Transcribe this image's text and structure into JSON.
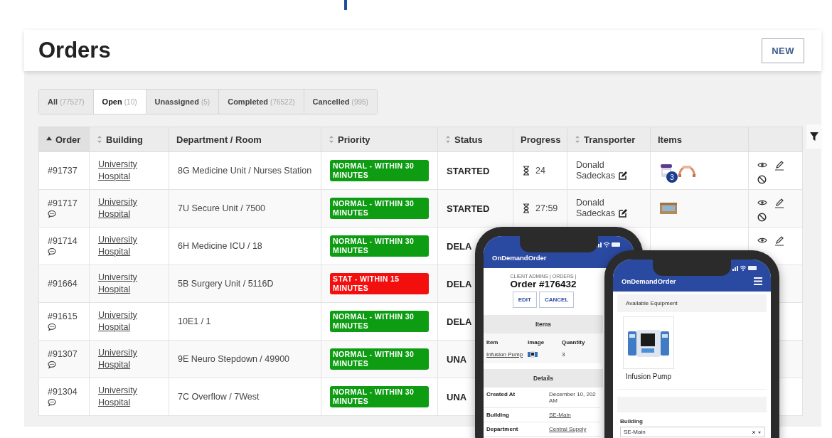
{
  "header": {
    "title": "Orders",
    "new_button": "NEW"
  },
  "tabs": [
    {
      "label": "All",
      "count": "(77527)",
      "selected": false
    },
    {
      "label": "Open",
      "count": "(10)",
      "selected": true
    },
    {
      "label": "Unassigned",
      "count": "(5)",
      "selected": false
    },
    {
      "label": "Completed",
      "count": "(76522)",
      "selected": false
    },
    {
      "label": "Cancelled",
      "count": "(995)",
      "selected": false
    }
  ],
  "table": {
    "columns": [
      {
        "label": "Order",
        "sorted": true
      },
      {
        "label": "Building",
        "sorted": false
      },
      {
        "label": "Department / Room"
      },
      {
        "label": "Priority",
        "sorted": false
      },
      {
        "label": "Status",
        "sorted": false
      },
      {
        "label": "Progress"
      },
      {
        "label": "Transporter",
        "sorted": false
      },
      {
        "label": "Items"
      }
    ],
    "rows": [
      {
        "order": "#91737",
        "comment": false,
        "building": "University Hospital",
        "department": "8G Medicine Unit / Nurses Station",
        "priority": {
          "label": "NORMAL - WITHIN 30 MINUTES",
          "kind": "normal"
        },
        "status": "STARTED",
        "progress": "24",
        "transporter": "Donald Sadeckas",
        "items": [
          {
            "kind": "jar",
            "badge": "3"
          },
          {
            "kind": "strap"
          }
        ],
        "actions": [
          {
            "kind": "view"
          },
          {
            "kind": "edit"
          },
          {
            "kind": "cancel"
          }
        ]
      },
      {
        "order": "#91717",
        "comment": true,
        "building": "University Hospital",
        "department": "7U Secure Unit / 7500",
        "priority": {
          "label": "NORMAL - WITHIN 30 MINUTES",
          "kind": "normal"
        },
        "status": "STARTED",
        "progress": "27:59",
        "transporter": "Donald Sadeckas",
        "items": [
          {
            "kind": "box"
          }
        ],
        "actions": [
          {
            "kind": "view"
          },
          {
            "kind": "edit"
          },
          {
            "kind": "cancel"
          }
        ]
      },
      {
        "order": "#91714",
        "comment": true,
        "building": "University Hospital",
        "department": "6H Medicine ICU / 18",
        "priority": {
          "label": "NORMAL - WITHIN 30 MINUTES",
          "kind": "normal"
        },
        "status": "DELA",
        "actions": [
          {
            "kind": "view"
          },
          {
            "kind": "edit"
          }
        ]
      },
      {
        "order": "#91664",
        "comment": false,
        "building": "University Hospital",
        "department": "5B Surgery Unit / 5116D",
        "priority": {
          "label": "STAT - WITHIN 15 MINUTES",
          "kind": "stat"
        },
        "status": "DELA"
      },
      {
        "order": "#91615",
        "comment": true,
        "building": "University Hospital",
        "department": "10E1 / 1",
        "priority": {
          "label": "NORMAL - WITHIN 30 MINUTES",
          "kind": "normal"
        },
        "status": "DELA"
      },
      {
        "order": "#91307",
        "comment": true,
        "building": "University Hospital",
        "department": "9E Neuro Stepdown / 49900",
        "priority": {
          "label": "NORMAL - WITHIN 30 MINUTES",
          "kind": "normal"
        },
        "status": "UNA"
      },
      {
        "order": "#91304",
        "comment": true,
        "building": "University Hospital",
        "department": "7C Overflow / 7West",
        "priority": {
          "label": "NORMAL - WITHIN 30 MINUTES",
          "kind": "normal"
        },
        "status": "UNA"
      }
    ]
  },
  "phones": [
    {
      "app_title": "OnDemandOrder",
      "breadcrumb": "CLIENT ADMINS | ORDERS |",
      "order_title": "Order #176432",
      "buttons": [
        "EDIT",
        "CANCEL"
      ],
      "items_section": {
        "title": "Items",
        "columns": [
          "Item",
          "Image",
          "Quantity"
        ],
        "rows": [
          {
            "item": "Infusion Pump",
            "quantity": "3"
          }
        ]
      },
      "details_section": {
        "title": "Details",
        "rows": [
          {
            "label": "Created At",
            "value": "December 10, 202 AM",
            "link": false
          },
          {
            "label": "Building",
            "value": "SE-Main",
            "link": true
          },
          {
            "label": "Department",
            "value": "Central Supply",
            "link": true
          }
        ]
      }
    },
    {
      "app_title": "OnDemandOrder",
      "menu": true,
      "section": "Available Equipment",
      "equipment": [
        {
          "name": "Infusion Pump"
        }
      ],
      "field": {
        "label": "Building",
        "value": "SE-Main"
      }
    }
  ]
}
